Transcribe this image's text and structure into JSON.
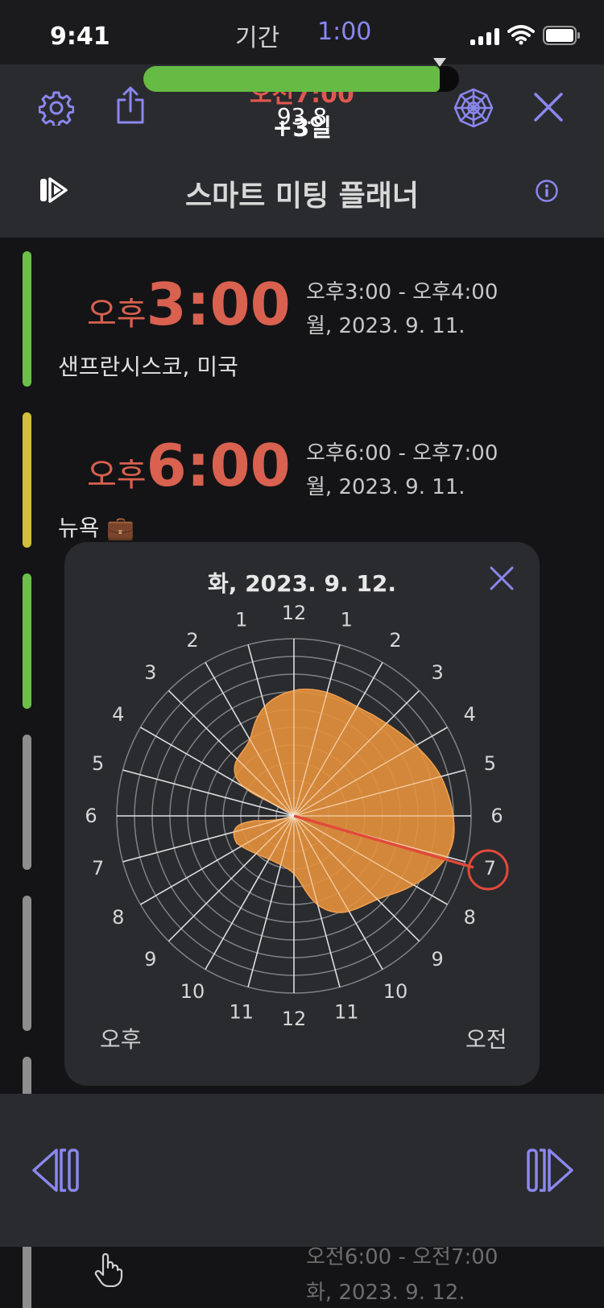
{
  "status_bar": {
    "time": "9:41"
  },
  "header": {
    "alarm_time": "오전7:00",
    "day_offset": "+3일",
    "title": "스마트 미팅 플래너",
    "icons": [
      "gear-icon",
      "share-icon",
      "web-icon",
      "close-icon",
      "play-forward-icon",
      "info-icon"
    ]
  },
  "meetings": [
    {
      "ampm": "오후",
      "time": "3:00",
      "range": "오후3:00 - 오후4:00",
      "date": "월, 2023. 9. 11.",
      "city": "샌프란시스코, 미국",
      "bar_color": "#6cc04a"
    },
    {
      "ampm": "오후",
      "time": "6:00",
      "range": "오후6:00 - 오후7:00",
      "date": "월, 2023. 9. 11.",
      "city": "뉴욕 💼",
      "bar_color": "#d2bf3a"
    },
    {
      "bar_color": "#6cc04a"
    },
    {
      "bar_color": "#8e8e8e"
    },
    {
      "bar_color": "#8e8e8e"
    },
    {
      "bar_color": "#8e8e8e"
    },
    {
      "range": "오전6:00 - 오전7:00",
      "date": "화, 2023. 9. 12.",
      "bar_color": "#8e8e8e"
    }
  ],
  "popup": {
    "date": "화, 2023. 9. 12.",
    "pm_label": "오후",
    "am_label": "오전",
    "chart_data": {
      "type": "polar-area",
      "hours_left_pm": [
        "12",
        "1",
        "2",
        "3",
        "4",
        "5",
        "6",
        "7",
        "8",
        "9",
        "10",
        "11"
      ],
      "hours_right_am": [
        "12",
        "1",
        "2",
        "3",
        "4",
        "5",
        "6",
        "7",
        "8",
        "9",
        "10",
        "11"
      ],
      "highlight_hour": "7",
      "highlight_side": "오전",
      "fill_color": "#e6913c",
      "accent_color": "#e04a3a"
    }
  },
  "player": {
    "duration_label": "기간",
    "duration_value": "1:00",
    "slider_fraction": 0.938,
    "slider_value": "93.8",
    "accent": "#8b87f0"
  }
}
